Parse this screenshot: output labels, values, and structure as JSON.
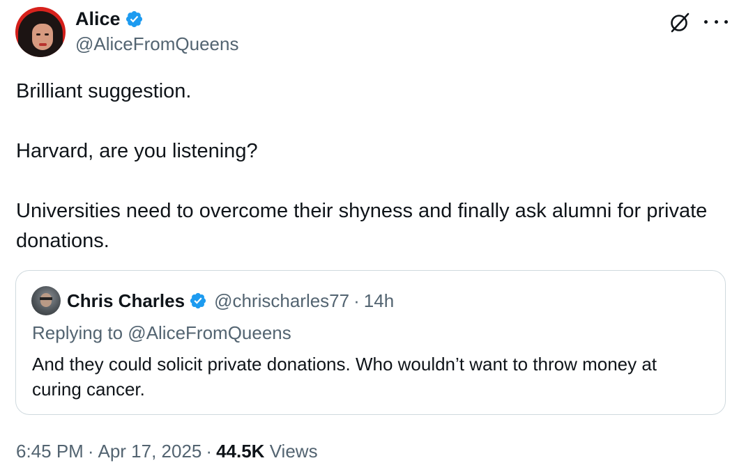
{
  "author": {
    "display_name": "Alice",
    "handle": "@AliceFromQueens"
  },
  "tweet": {
    "paragraphs": [
      "Brilliant suggestion.",
      "Harvard, are you listening?",
      "Universities need to overcome their shyness and finally ask alumni for private donations."
    ]
  },
  "quote": {
    "display_name": "Chris Charles",
    "handle": "@chrischarles77",
    "separator": "·",
    "time": "14h",
    "replying_to": "Replying to @AliceFromQueens",
    "text": "And they could solicit private donations.  Who wouldn’t want to throw money at curing cancer."
  },
  "meta": {
    "time": "6:45 PM",
    "separator": "·",
    "date": "Apr 17, 2025",
    "views_count": "44.5K",
    "views_label": "Views"
  },
  "icons": {
    "verified": "verified-badge-icon",
    "grok": "grok-icon",
    "more": "more-options-icon"
  },
  "colors": {
    "verified_blue": "#1d9bf0",
    "secondary_text": "#536471",
    "primary_text": "#0f1419",
    "border": "#cfd9de"
  }
}
